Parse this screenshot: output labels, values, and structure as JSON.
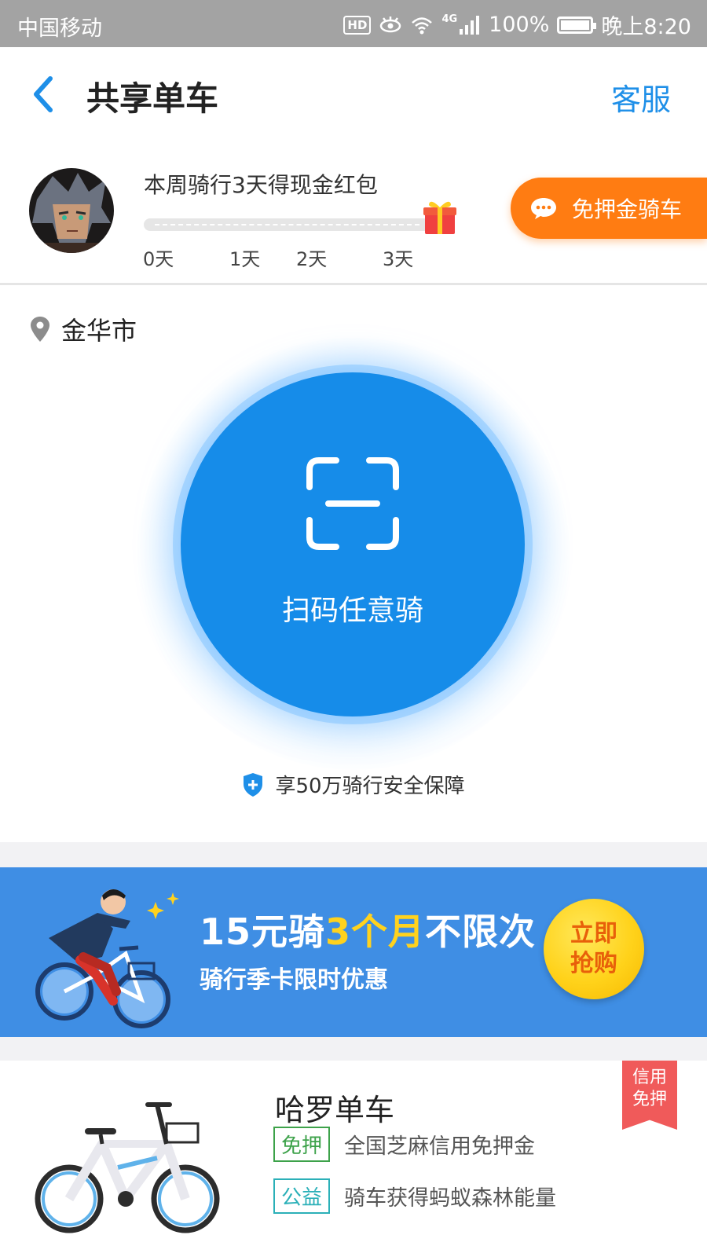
{
  "status_bar": {
    "carrier": "中国移动",
    "hd": "HD",
    "network": "4G",
    "battery": "100%",
    "time": "晚上8:20"
  },
  "header": {
    "title": "共享单车",
    "service_label": "客服"
  },
  "rider_card": {
    "reward_title": "本周骑行3天得现金红包",
    "progress_days_completed": 0,
    "day_labels": [
      "0天",
      "1天",
      "2天",
      "3天"
    ],
    "deposit_free_label": "免押金骑车"
  },
  "location": {
    "city": "金华市"
  },
  "scan": {
    "label": "扫码任意骑"
  },
  "insurance": {
    "text": "享50万骑行安全保障"
  },
  "promo_banner": {
    "headline_part1": "15元骑",
    "headline_highlight": "3个月",
    "headline_part2": "不限次",
    "subline": "骑行季卡限时优惠",
    "buy_line1": "立即",
    "buy_line2": "抢购"
  },
  "bike_card": {
    "name": "哈罗单车",
    "ribbon_line1": "信用",
    "ribbon_line2": "免押",
    "features": [
      {
        "tag": "免押",
        "desc": "全国芝麻信用免押金"
      },
      {
        "tag": "公益",
        "desc": "骑车获得蚂蚁森林能量"
      }
    ]
  },
  "colors": {
    "accent_blue": "#1e8fe8",
    "scan_blue": "#168ce9",
    "banner_blue": "#3f8ee4",
    "orange": "#ff7c12",
    "ribbon_red": "#f05a5a"
  }
}
